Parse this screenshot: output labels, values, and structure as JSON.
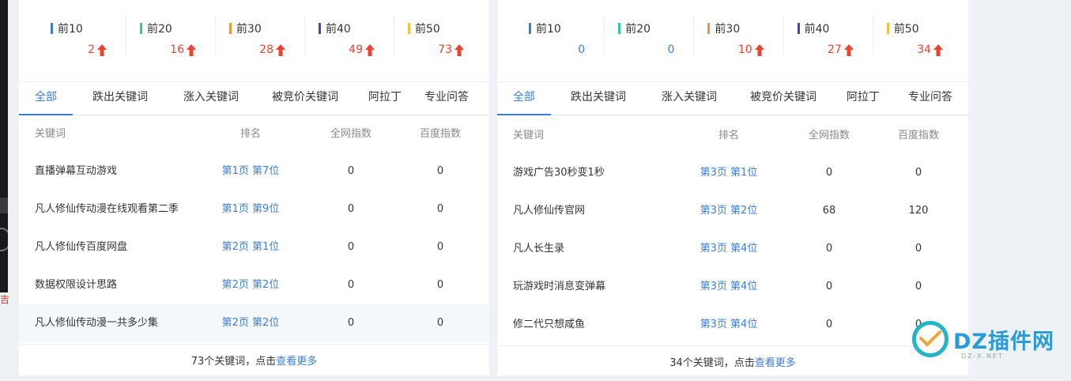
{
  "left_chip_text": "吉",
  "panels": [
    {
      "stats": [
        {
          "label": "前10",
          "value": "2",
          "color": "#3c7dd2",
          "value_style": "red",
          "trend": "up"
        },
        {
          "label": "前20",
          "value": "16",
          "color": "#36c3a4",
          "value_style": "red",
          "trend": "up"
        },
        {
          "label": "前30",
          "value": "28",
          "color": "#f0973d",
          "value_style": "red",
          "trend": "up"
        },
        {
          "label": "前40",
          "value": "49",
          "color": "#3b47c9",
          "value_style": "red",
          "trend": "up"
        },
        {
          "label": "前50",
          "value": "73",
          "color": "#f4c23d",
          "value_style": "red",
          "trend": "up"
        }
      ],
      "tabs": [
        "全部",
        "跌出关键词",
        "涨入关键词",
        "被竞价关键词",
        "阿拉丁",
        "专业问答"
      ],
      "active_tab": 0,
      "columns": [
        "关键词",
        "排名",
        "全网指数",
        "百度指数"
      ],
      "rows": [
        {
          "keyword": "直播弹幕互动游戏",
          "rank": "第1页 第7位",
          "all_index": "0",
          "baidu_index": "0"
        },
        {
          "keyword": "凡人修仙传动漫在线观看第二季",
          "rank": "第1页 第9位",
          "all_index": "0",
          "baidu_index": "0"
        },
        {
          "keyword": "凡人修仙传百度网盘",
          "rank": "第2页 第1位",
          "all_index": "0",
          "baidu_index": "0"
        },
        {
          "keyword": "数据权限设计思路",
          "rank": "第2页 第2位",
          "all_index": "0",
          "baidu_index": "0"
        },
        {
          "keyword": "凡人修仙传动漫一共多少集",
          "rank": "第2页 第2位",
          "all_index": "0",
          "baidu_index": "0"
        }
      ],
      "highlighted_row": 4,
      "footer_count": "73个关键词，点击",
      "footer_link": "查看更多"
    },
    {
      "stats": [
        {
          "label": "前10",
          "value": "0",
          "color": "#3c7dd2",
          "value_style": "blue",
          "trend": "none"
        },
        {
          "label": "前20",
          "value": "0",
          "color": "#36c3a4",
          "value_style": "blue",
          "trend": "none"
        },
        {
          "label": "前30",
          "value": "10",
          "color": "#f0973d",
          "value_style": "red",
          "trend": "up"
        },
        {
          "label": "前40",
          "value": "27",
          "color": "#3b47c9",
          "value_style": "red",
          "trend": "up"
        },
        {
          "label": "前50",
          "value": "34",
          "color": "#f4c23d",
          "value_style": "red",
          "trend": "up"
        }
      ],
      "tabs": [
        "全部",
        "跌出关键词",
        "涨入关键词",
        "被竞价关键词",
        "阿拉丁",
        "专业问答"
      ],
      "active_tab": 0,
      "columns": [
        "关键词",
        "排名",
        "全网指数",
        "百度指数"
      ],
      "rows": [
        {
          "keyword": "游戏广告30秒变1秒",
          "rank": "第3页 第1位",
          "all_index": "0",
          "baidu_index": "0"
        },
        {
          "keyword": "凡人修仙传官网",
          "rank": "第3页 第2位",
          "all_index": "68",
          "baidu_index": "120"
        },
        {
          "keyword": "凡人长生录",
          "rank": "第3页 第4位",
          "all_index": "0",
          "baidu_index": "0"
        },
        {
          "keyword": "玩游戏时消息变弹幕",
          "rank": "第3页 第4位",
          "all_index": "0",
          "baidu_index": "0"
        },
        {
          "keyword": "修二代只想咸鱼",
          "rank": "第3页 第4位",
          "all_index": "0",
          "baidu_index": "0"
        }
      ],
      "highlighted_row": -1,
      "footer_count": "34个关键词，点击",
      "footer_link": "查看更多"
    }
  ],
  "watermark": {
    "main": "DZ插件网",
    "sub": "DZ-X.NET",
    "accent": "#2a9bd7"
  }
}
